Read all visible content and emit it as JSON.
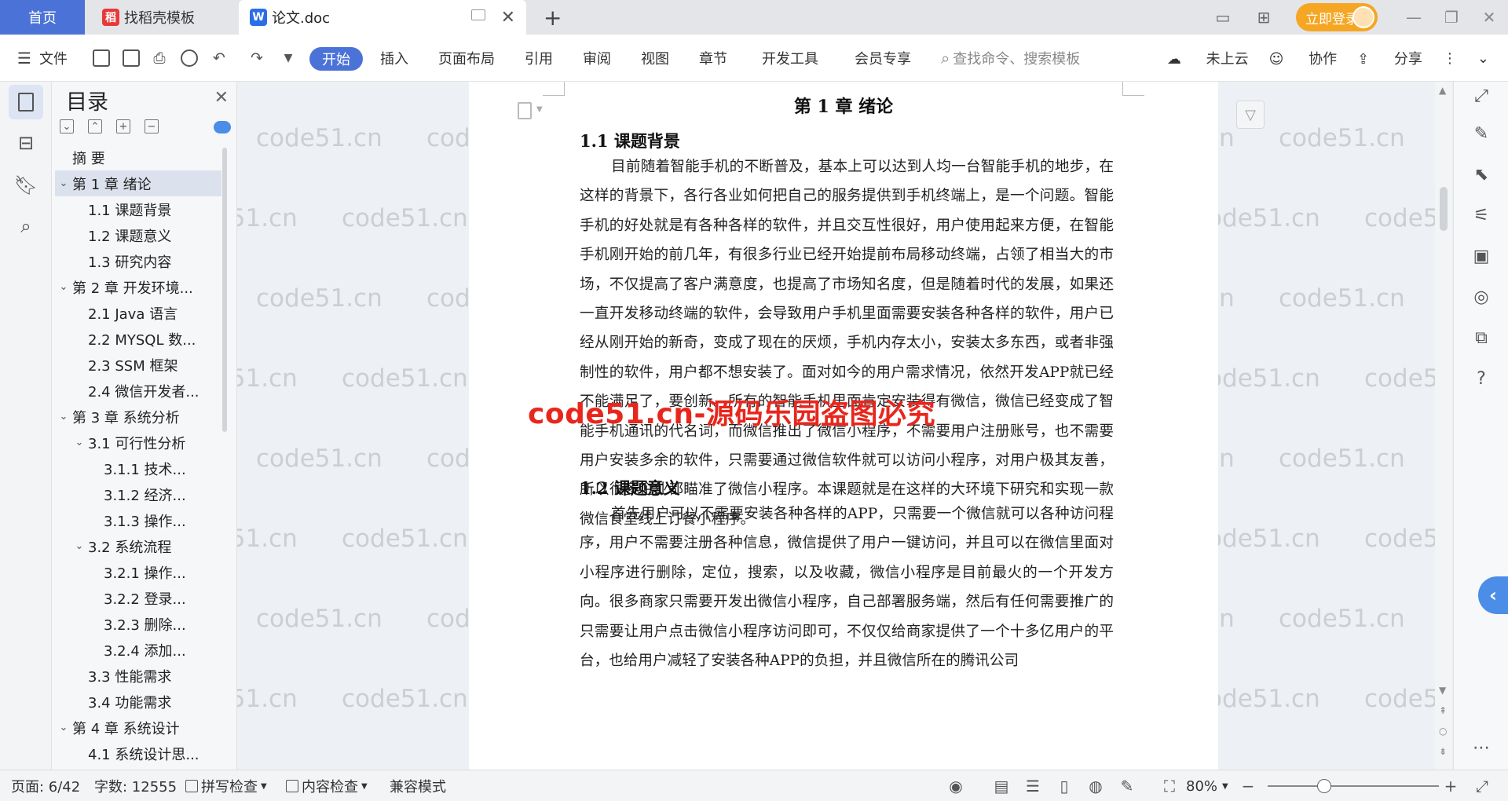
{
  "tabs": {
    "home": "首页",
    "daoke": "找稻壳模板",
    "doc": "论文.doc"
  },
  "titlebar": {
    "login": "立即登录"
  },
  "toolbar": {
    "file": "文件",
    "menus": [
      "开始",
      "插入",
      "页面布局",
      "引用",
      "审阅",
      "视图",
      "章节",
      "开发工具",
      "会员专享"
    ],
    "search_placeholder": "查找命令、搜索模板",
    "cloud": "未上云",
    "collab": "协作",
    "share": "分享"
  },
  "toc": {
    "title": "目录",
    "items": [
      {
        "label": "摘    要",
        "level": 0,
        "expandable": false
      },
      {
        "label": "第 1 章  绪论",
        "level": 0,
        "expandable": true,
        "selected": true
      },
      {
        "label": "1.1  课题背景",
        "level": 1,
        "expandable": false
      },
      {
        "label": "1.2  课题意义",
        "level": 1,
        "expandable": false
      },
      {
        "label": "1.3  研究内容",
        "level": 1,
        "expandable": false
      },
      {
        "label": "第 2 章  开发环境...",
        "level": 0,
        "expandable": true
      },
      {
        "label": "2.1 Java 语言",
        "level": 1,
        "expandable": false
      },
      {
        "label": "2.2 MYSQL 数...",
        "level": 1,
        "expandable": false
      },
      {
        "label": "2.3 SSM 框架",
        "level": 1,
        "expandable": false
      },
      {
        "label": "2.4 微信开发者...",
        "level": 1,
        "expandable": false
      },
      {
        "label": "第 3 章  系统分析",
        "level": 0,
        "expandable": true
      },
      {
        "label": "3.1  可行性分析",
        "level": 1,
        "expandable": true
      },
      {
        "label": "3.1.1  技术...",
        "level": 2,
        "expandable": false
      },
      {
        "label": "3.1.2  经济...",
        "level": 2,
        "expandable": false
      },
      {
        "label": "3.1.3  操作...",
        "level": 2,
        "expandable": false
      },
      {
        "label": "3.2  系统流程",
        "level": 1,
        "expandable": true
      },
      {
        "label": "3.2.1  操作...",
        "level": 2,
        "expandable": false
      },
      {
        "label": "3.2.2  登录...",
        "level": 2,
        "expandable": false
      },
      {
        "label": "3.2.3  删除...",
        "level": 2,
        "expandable": false
      },
      {
        "label": "3.2.4  添加...",
        "level": 2,
        "expandable": false
      },
      {
        "label": "3.3  性能需求",
        "level": 1,
        "expandable": false
      },
      {
        "label": "3.4  功能需求",
        "level": 1,
        "expandable": false
      },
      {
        "label": "第 4 章  系统设计",
        "level": 0,
        "expandable": true
      },
      {
        "label": "4.1  系统设计思...",
        "level": 1,
        "expandable": false
      }
    ]
  },
  "document": {
    "chapter": "第 1 章  绪论",
    "sections": [
      {
        "heading": "1.1  课题背景",
        "paragraph": "目前随着智能手机的不断普及，基本上可以达到人均一台智能手机的地步，在这样的背景下，各行各业如何把自己的服务提供到手机终端上，是一个问题。智能手机的好处就是有各种各样的软件，并且交互性很好，用户使用起来方便，在智能手机刚开始的前几年，有很多行业已经开始提前布局移动终端，占领了相当大的市场，不仅提高了客户满意度，也提高了市场知名度，但是随着时代的发展，如果还一直开发移动终端的软件，会导致用户手机里面需要安装各种各样的软件，用户已经从刚开始的新奇，变成了现在的厌烦，手机内存太小，安装太多东西，或者非强制性的软件，用户都不想安装了。面对如今的用户需求情况，依然开发APP就已经不能满足了，要创新。所有的智能手机里面肯定安装得有微信，微信已经变成了智能手机通讯的代名词，而微信推出了微信小程序，不需要用户注册账号，也不需要用户安装多余的软件，只需要通过微信软件就可以访问小程序，对用户极其友善，所以很多企业都瞄准了微信小程序。本课题就是在这样的大环境下研究和实现一款微信食堂线上订餐小程序。"
      },
      {
        "heading": "1.2  课题意义",
        "paragraph": "首先用户可以不需要安装各种各样的APP，只需要一个微信就可以各种访问程序，用户不需要注册各种信息，微信提供了用户一键访问，并且可以在微信里面对小程序进行删除，定位，搜索，以及收藏，微信小程序是目前最火的一个开发方向。很多商家只需要开发出微信小程序，自己部署服务端，然后有任何需要推广的只需要让用户点击微信小程序访问即可，不仅仅给商家提供了一个十多亿用户的平台，也给用户减轻了安装各种APP的负担，并且微信所在的腾讯公司"
      }
    ]
  },
  "watermark": {
    "text": "code51.cn",
    "overlay": "code51.cn-源码乐园盗图必究",
    "overlay_color": "#e8261c"
  },
  "status": {
    "page": "页面: 6/42",
    "words": "字数: 12555",
    "spell": "拼写检查",
    "content_check": "内容检查",
    "compat": "兼容模式",
    "zoom": "80%",
    "zoom_fraction": 0.33
  },
  "colors": {
    "accent": "#4b73d7",
    "login": "#f5a623"
  }
}
